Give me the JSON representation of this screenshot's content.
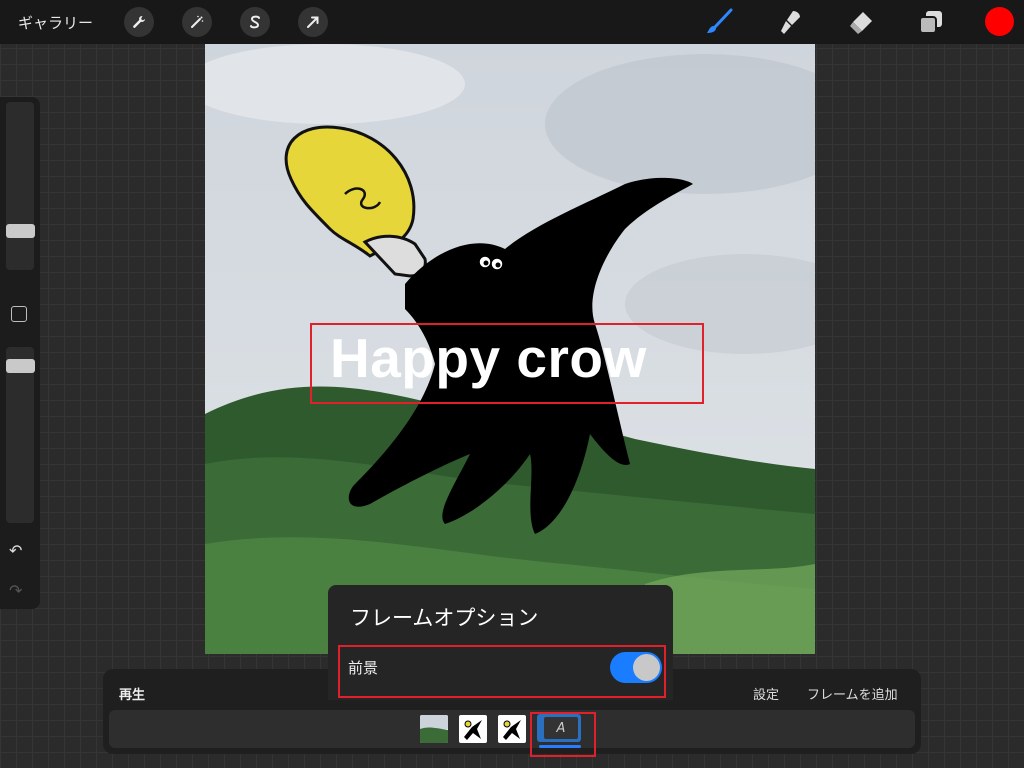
{
  "topbar": {
    "gallery_label": "ギャラリー",
    "tools": [
      "wrench-icon",
      "magic-wand-icon",
      "selection-s-icon",
      "transform-arrow-icon"
    ],
    "right_tools": [
      "brush-icon",
      "smudge-icon",
      "eraser-icon",
      "layers-icon"
    ],
    "current_color": "#ff0000"
  },
  "canvas": {
    "text_layer": "Happy crow"
  },
  "popover": {
    "title": "フレームオプション",
    "row_label": "前景",
    "toggle_on": true
  },
  "timeline": {
    "play_label": "再生",
    "settings_label": "設定",
    "add_frame_label": "フレームを追加",
    "frames": [
      "landscape-thumbnail",
      "crow-thumbnail",
      "crow-thumbnail",
      "text-thumbnail"
    ],
    "selected_frame_glyph": "A"
  },
  "colors": {
    "accent": "#1a7cff",
    "highlight": "#e0202a"
  }
}
